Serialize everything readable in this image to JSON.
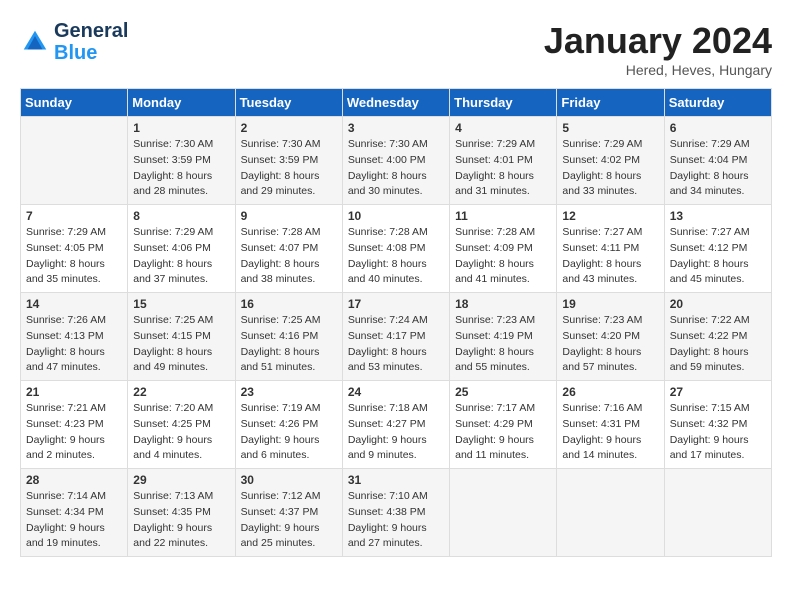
{
  "header": {
    "logo_line1": "General",
    "logo_line2": "Blue",
    "month": "January 2024",
    "location": "Hered, Heves, Hungary"
  },
  "columns": [
    "Sunday",
    "Monday",
    "Tuesday",
    "Wednesday",
    "Thursday",
    "Friday",
    "Saturday"
  ],
  "weeks": [
    [
      {
        "day": "",
        "lines": []
      },
      {
        "day": "1",
        "lines": [
          "Sunrise: 7:30 AM",
          "Sunset: 3:59 PM",
          "Daylight: 8 hours",
          "and 28 minutes."
        ]
      },
      {
        "day": "2",
        "lines": [
          "Sunrise: 7:30 AM",
          "Sunset: 3:59 PM",
          "Daylight: 8 hours",
          "and 29 minutes."
        ]
      },
      {
        "day": "3",
        "lines": [
          "Sunrise: 7:30 AM",
          "Sunset: 4:00 PM",
          "Daylight: 8 hours",
          "and 30 minutes."
        ]
      },
      {
        "day": "4",
        "lines": [
          "Sunrise: 7:29 AM",
          "Sunset: 4:01 PM",
          "Daylight: 8 hours",
          "and 31 minutes."
        ]
      },
      {
        "day": "5",
        "lines": [
          "Sunrise: 7:29 AM",
          "Sunset: 4:02 PM",
          "Daylight: 8 hours",
          "and 33 minutes."
        ]
      },
      {
        "day": "6",
        "lines": [
          "Sunrise: 7:29 AM",
          "Sunset: 4:04 PM",
          "Daylight: 8 hours",
          "and 34 minutes."
        ]
      }
    ],
    [
      {
        "day": "7",
        "lines": [
          "Sunrise: 7:29 AM",
          "Sunset: 4:05 PM",
          "Daylight: 8 hours",
          "and 35 minutes."
        ]
      },
      {
        "day": "8",
        "lines": [
          "Sunrise: 7:29 AM",
          "Sunset: 4:06 PM",
          "Daylight: 8 hours",
          "and 37 minutes."
        ]
      },
      {
        "day": "9",
        "lines": [
          "Sunrise: 7:28 AM",
          "Sunset: 4:07 PM",
          "Daylight: 8 hours",
          "and 38 minutes."
        ]
      },
      {
        "day": "10",
        "lines": [
          "Sunrise: 7:28 AM",
          "Sunset: 4:08 PM",
          "Daylight: 8 hours",
          "and 40 minutes."
        ]
      },
      {
        "day": "11",
        "lines": [
          "Sunrise: 7:28 AM",
          "Sunset: 4:09 PM",
          "Daylight: 8 hours",
          "and 41 minutes."
        ]
      },
      {
        "day": "12",
        "lines": [
          "Sunrise: 7:27 AM",
          "Sunset: 4:11 PM",
          "Daylight: 8 hours",
          "and 43 minutes."
        ]
      },
      {
        "day": "13",
        "lines": [
          "Sunrise: 7:27 AM",
          "Sunset: 4:12 PM",
          "Daylight: 8 hours",
          "and 45 minutes."
        ]
      }
    ],
    [
      {
        "day": "14",
        "lines": [
          "Sunrise: 7:26 AM",
          "Sunset: 4:13 PM",
          "Daylight: 8 hours",
          "and 47 minutes."
        ]
      },
      {
        "day": "15",
        "lines": [
          "Sunrise: 7:25 AM",
          "Sunset: 4:15 PM",
          "Daylight: 8 hours",
          "and 49 minutes."
        ]
      },
      {
        "day": "16",
        "lines": [
          "Sunrise: 7:25 AM",
          "Sunset: 4:16 PM",
          "Daylight: 8 hours",
          "and 51 minutes."
        ]
      },
      {
        "day": "17",
        "lines": [
          "Sunrise: 7:24 AM",
          "Sunset: 4:17 PM",
          "Daylight: 8 hours",
          "and 53 minutes."
        ]
      },
      {
        "day": "18",
        "lines": [
          "Sunrise: 7:23 AM",
          "Sunset: 4:19 PM",
          "Daylight: 8 hours",
          "and 55 minutes."
        ]
      },
      {
        "day": "19",
        "lines": [
          "Sunrise: 7:23 AM",
          "Sunset: 4:20 PM",
          "Daylight: 8 hours",
          "and 57 minutes."
        ]
      },
      {
        "day": "20",
        "lines": [
          "Sunrise: 7:22 AM",
          "Sunset: 4:22 PM",
          "Daylight: 8 hours",
          "and 59 minutes."
        ]
      }
    ],
    [
      {
        "day": "21",
        "lines": [
          "Sunrise: 7:21 AM",
          "Sunset: 4:23 PM",
          "Daylight: 9 hours",
          "and 2 minutes."
        ]
      },
      {
        "day": "22",
        "lines": [
          "Sunrise: 7:20 AM",
          "Sunset: 4:25 PM",
          "Daylight: 9 hours",
          "and 4 minutes."
        ]
      },
      {
        "day": "23",
        "lines": [
          "Sunrise: 7:19 AM",
          "Sunset: 4:26 PM",
          "Daylight: 9 hours",
          "and 6 minutes."
        ]
      },
      {
        "day": "24",
        "lines": [
          "Sunrise: 7:18 AM",
          "Sunset: 4:27 PM",
          "Daylight: 9 hours",
          "and 9 minutes."
        ]
      },
      {
        "day": "25",
        "lines": [
          "Sunrise: 7:17 AM",
          "Sunset: 4:29 PM",
          "Daylight: 9 hours",
          "and 11 minutes."
        ]
      },
      {
        "day": "26",
        "lines": [
          "Sunrise: 7:16 AM",
          "Sunset: 4:31 PM",
          "Daylight: 9 hours",
          "and 14 minutes."
        ]
      },
      {
        "day": "27",
        "lines": [
          "Sunrise: 7:15 AM",
          "Sunset: 4:32 PM",
          "Daylight: 9 hours",
          "and 17 minutes."
        ]
      }
    ],
    [
      {
        "day": "28",
        "lines": [
          "Sunrise: 7:14 AM",
          "Sunset: 4:34 PM",
          "Daylight: 9 hours",
          "and 19 minutes."
        ]
      },
      {
        "day": "29",
        "lines": [
          "Sunrise: 7:13 AM",
          "Sunset: 4:35 PM",
          "Daylight: 9 hours",
          "and 22 minutes."
        ]
      },
      {
        "day": "30",
        "lines": [
          "Sunrise: 7:12 AM",
          "Sunset: 4:37 PM",
          "Daylight: 9 hours",
          "and 25 minutes."
        ]
      },
      {
        "day": "31",
        "lines": [
          "Sunrise: 7:10 AM",
          "Sunset: 4:38 PM",
          "Daylight: 9 hours",
          "and 27 minutes."
        ]
      },
      {
        "day": "",
        "lines": []
      },
      {
        "day": "",
        "lines": []
      },
      {
        "day": "",
        "lines": []
      }
    ]
  ]
}
